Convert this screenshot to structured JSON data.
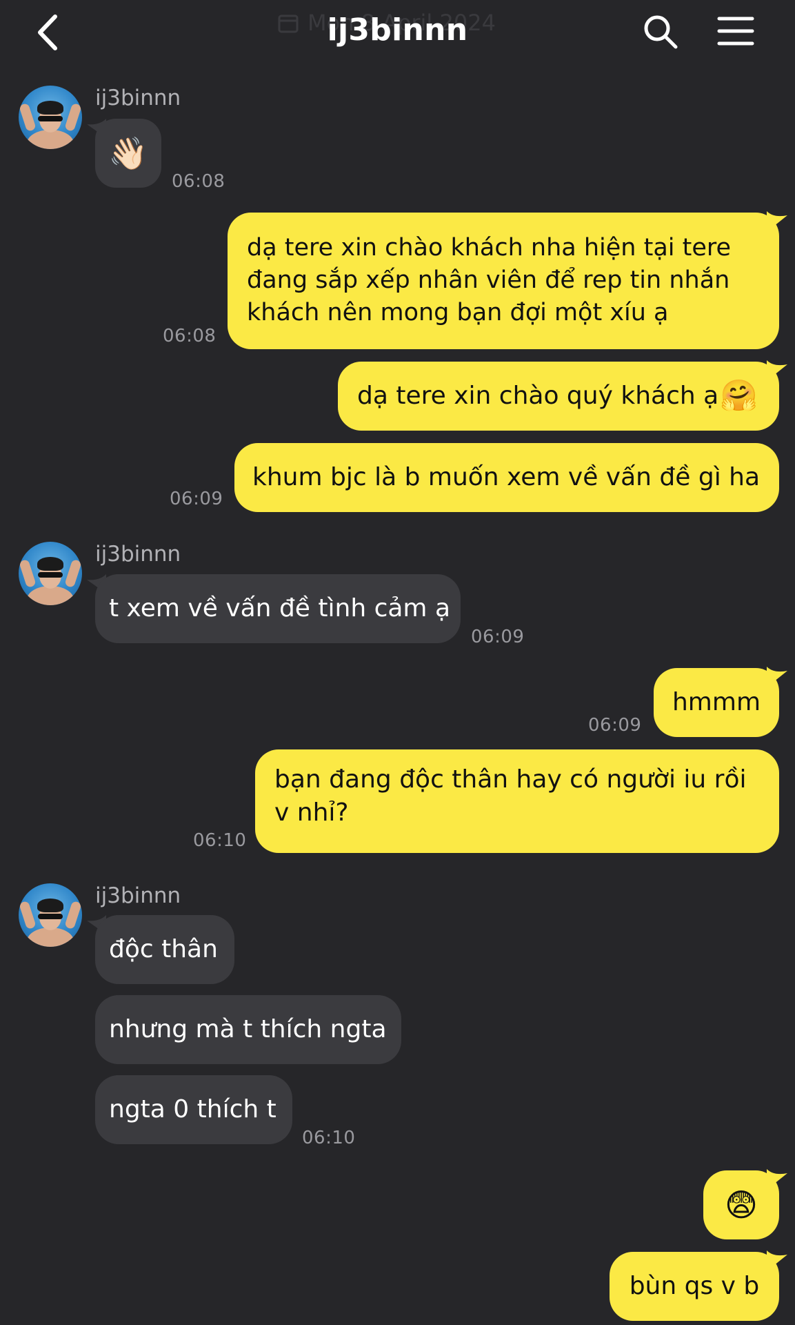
{
  "header": {
    "title": "ij3binnn",
    "date_faded": "Mon 8 April 2024"
  },
  "messages": [
    {
      "sender": "ij3binnn",
      "text": "👋🏻",
      "time": "06:08"
    },
    {
      "lines": [
        "dạ tere xin chào khách nha  hiện tại tere",
        "đang sắp xếp nhân viên để rep tin nhắn",
        "khách nên mong bạn đợi một xíu ạ"
      ],
      "time": "06:08"
    },
    {
      "text": "dạ tere xin chào quý khách ạ"
    },
    {
      "text": "khum bjc là b muốn xem về vấn đề gì ha",
      "time": "06:09"
    },
    {
      "sender": "ij3binnn",
      "text": "t xem về vấn đề tình cảm ạ",
      "time": "06:09"
    },
    {
      "text": "hmmm",
      "time": "06:09"
    },
    {
      "lines": [
        "bạn đang độc thân hay có người iu rồi",
        "v nhỉ?"
      ],
      "time": "06:10"
    },
    {
      "sender": "ij3binnn",
      "text": "độc thân"
    },
    {
      "text": "nhưng mà t thích ngta"
    },
    {
      "text": "ngta 0 thích t",
      "time": "06:10"
    },
    {
      "text": "😨"
    },
    {
      "text": "bùn qs v b"
    }
  ],
  "colors": {
    "background": "#262629",
    "incoming_bubble": "#3b3b3f",
    "outgoing_bubble": "#fbe945"
  },
  "icons": [
    "back-chevron-icon",
    "calendar-icon",
    "search-icon",
    "hamburger-menu-icon",
    "waving-hand-emoji",
    "hugging-face-emoji",
    "fearful-face-emoji"
  ]
}
